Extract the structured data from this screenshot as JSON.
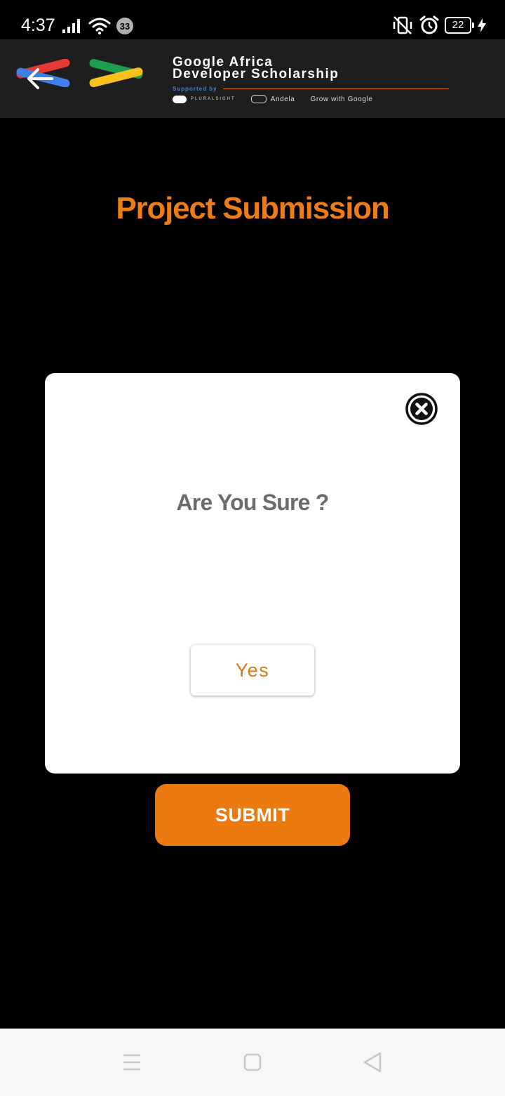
{
  "status_bar": {
    "time": "4:37",
    "notification_count": "33",
    "battery_level": "22",
    "icons": [
      "signal-icon",
      "wifi-icon",
      "notification-badge",
      "vibrate-off-icon",
      "alarm-icon",
      "battery-icon",
      "charging-icon"
    ]
  },
  "app_bar": {
    "brand_title_line1": "Google Africa",
    "brand_title_line2": "Developer Scholarship",
    "supported_by": "Supported by",
    "partners": {
      "pluralsight": "PLURALSIGHT",
      "andela": "Andela",
      "grow_with_google": "Grow with Google"
    },
    "icons": [
      "back-arrow-icon",
      "gads-logo-icon"
    ]
  },
  "page": {
    "title": "Project Submission"
  },
  "dialog": {
    "message": "Are You Sure ?",
    "confirm_label": "Yes",
    "icons": [
      "close-circle-icon"
    ]
  },
  "form": {
    "submit_label": "SUBMIT"
  },
  "nav_bar": {
    "icons": [
      "menu-icon",
      "home-icon",
      "back-icon"
    ]
  },
  "colors": {
    "accent": "#EC7A0F",
    "title": "#F07C16",
    "app_bar_bg": "#1E1E1E",
    "dialog_text": "#6B6B6B"
  }
}
